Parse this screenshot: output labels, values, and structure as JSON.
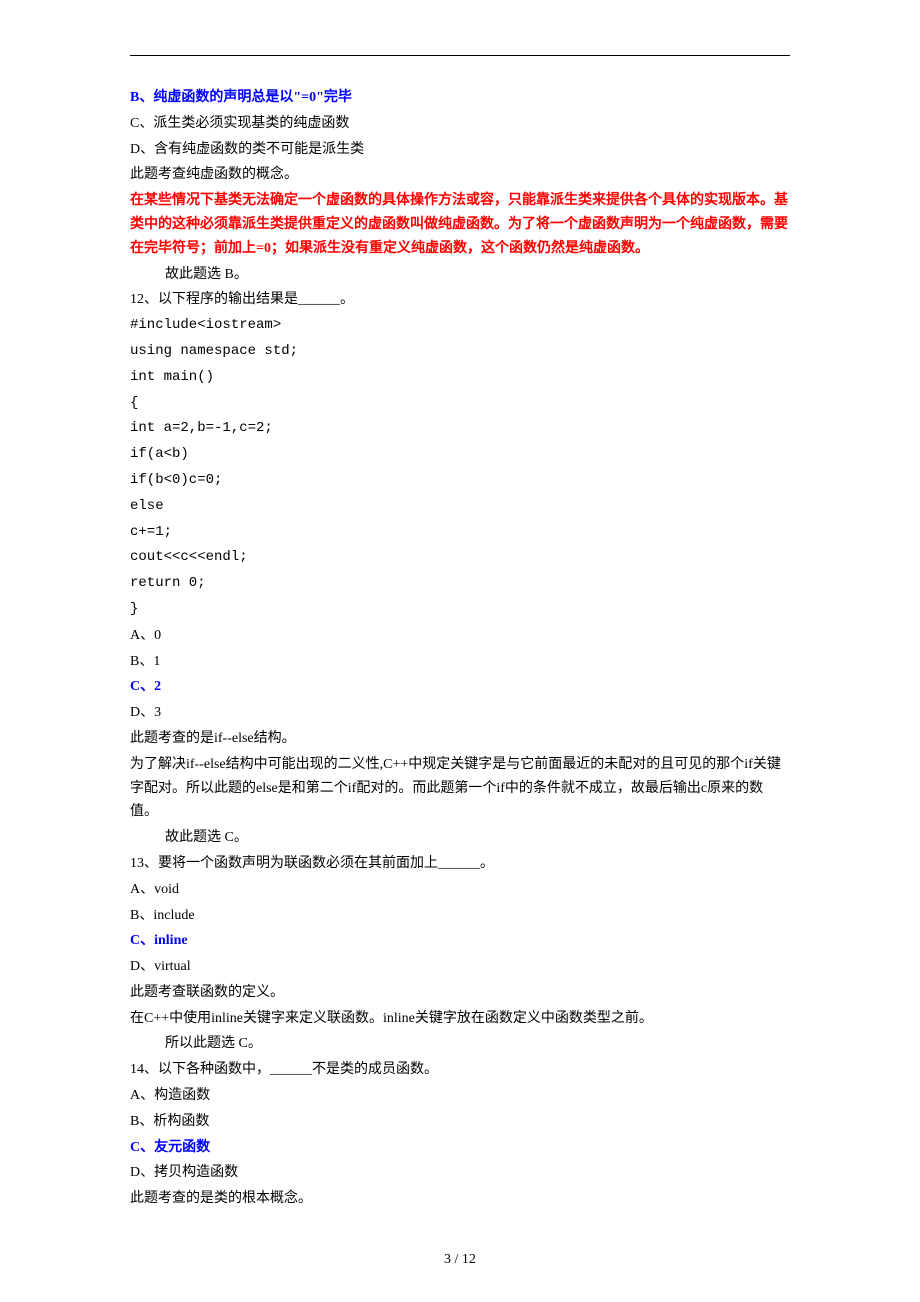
{
  "q11": {
    "optB": "B、纯虚函数的声明总是以\"=0\"完毕",
    "optC": "C、派生类必须实现基类的纯虚函数",
    "optD": "D、含有纯虚函数的类不可能是派生类",
    "expl1": "此题考查纯虚函数的概念。",
    "expl2": "在某些情况下基类无法确定一个虚函数的具体操作方法或容，只能靠派生类来提供各个具体的实现版本。基类中的这种必须靠派生类提供重定义的虚函数叫做纯虚函数。为了将一个虚函数声明为一个纯虚函数，需要在完毕符号；前加上=0；如果派生没有重定义纯虚函数，这个函数仍然是纯虚函数。",
    "ans": "故此题选 B。"
  },
  "q12": {
    "stem": "12、以下程序的输出结果是______。",
    "code1": "#include<iostream>",
    "code2": "using namespace std;",
    "code3": "int main()",
    "code4": "{",
    "code5": "int a=2,b=-1,c=2;",
    "code6": "if(a<b)",
    "code7": "if(b<0)c=0;",
    "code8": "else",
    "code9": "c+=1;",
    "code10": "cout<<c<<endl;",
    "code11": "return 0;",
    "code12": "}",
    "optA": "A、0",
    "optB": "B、1",
    "optC": "C、2",
    "optD": "D、3",
    "expl1": "此题考查的是if--else结构。",
    "expl2": "为了解决if--else结构中可能出现的二义性,C++中规定关键字是与它前面最近的未配对的且可见的那个if关键字配对。所以此题的else是和第二个if配对的。而此题第一个if中的条件就不成立，故最后输出c原来的数值。",
    "ans": "故此题选 C。"
  },
  "q13": {
    "stem": "13、要将一个函数声明为联函数必须在其前面加上______。",
    "optA": "A、void",
    "optB": "B、include",
    "optC": "C、inline",
    "optD": "D、virtual",
    "expl1": "此题考查联函数的定义。",
    "expl2": "在C++中使用inline关键字来定义联函数。inline关键字放在函数定义中函数类型之前。",
    "ans": "所以此题选 C。"
  },
  "q14": {
    "stem": "14、以下各种函数中，______不是类的成员函数。",
    "optA": "A、构造函数",
    "optB": "B、析构函数",
    "optC": "C、友元函数",
    "optD": "D、拷贝构造函数",
    "expl1": "此题考查的是类的根本概念。"
  },
  "footer": "3 / 12"
}
